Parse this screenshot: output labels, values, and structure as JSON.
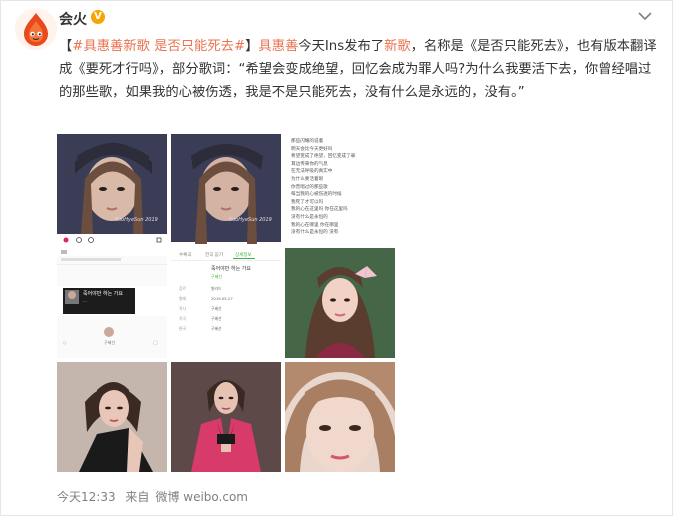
{
  "user": {
    "name": "会火",
    "verified_badge": "V"
  },
  "post": {
    "hashtag1": "#具惠善新歌",
    "hashtag2": "是否只能死去#",
    "bracket_open": "【",
    "bracket_close": "】",
    "mention": "具惠善",
    "part1": "今天Ins发布了",
    "new_song_link": "新歌",
    "part2": "，名称是《是否只能死去》，也有版本翻译成《要死才行吗》，部分歌词：“希望会变成绝望，回忆会成为罪人吗?为什么我要活下去，你曾经唱过的那些歌，如果我的心被伤透，我是不是只能死去，没有什么是永远的，没有。”"
  },
  "thumbs": {
    "img1_caption": "KooHyeSun 2019",
    "img2_caption": "KooHyeSun 2019",
    "img3_lyrics": [
      "那些闪耀的说着",
      "明天会比今天更好吗",
      "希望变成了绝望，回忆变成了罪",
      "耳边传来你的气息",
      "在无法呼吸的真实中",
      "为什么要活着呢",
      "你曾唱过的那些歌",
      "每当我的心被伤透的时候",
      "我死了才可以吗",
      "我的心在这里吗 你在这里吗",
      "没有什么是永恒的",
      "我的心在哪里 你在哪里",
      "没有什么是永恒的 没有"
    ],
    "img4_song_title": "죽어야만 하는 가요",
    "img4_artist": "구혜선",
    "img5_tabs": [
      "수록곡",
      "전곡 듣기",
      "상세정보"
    ],
    "img6_song_title": "죽어야만 하는 가요",
    "img6_artist": "구혜선",
    "img6_rows": [
      {
        "k": "장르",
        "v": "발라드"
      },
      {
        "k": "발매",
        "v": "2019.05.27"
      },
      {
        "k": "작사",
        "v": "구혜선"
      },
      {
        "k": "작곡",
        "v": "구혜선"
      },
      {
        "k": "편곡",
        "v": "구혜선"
      }
    ]
  },
  "footer": {
    "time": "今天12:33",
    "source_prefix": "来自",
    "source": "微博 weibo.com"
  },
  "colors": {
    "accent": "#eb7350",
    "text": "#333333",
    "muted": "#808080"
  }
}
